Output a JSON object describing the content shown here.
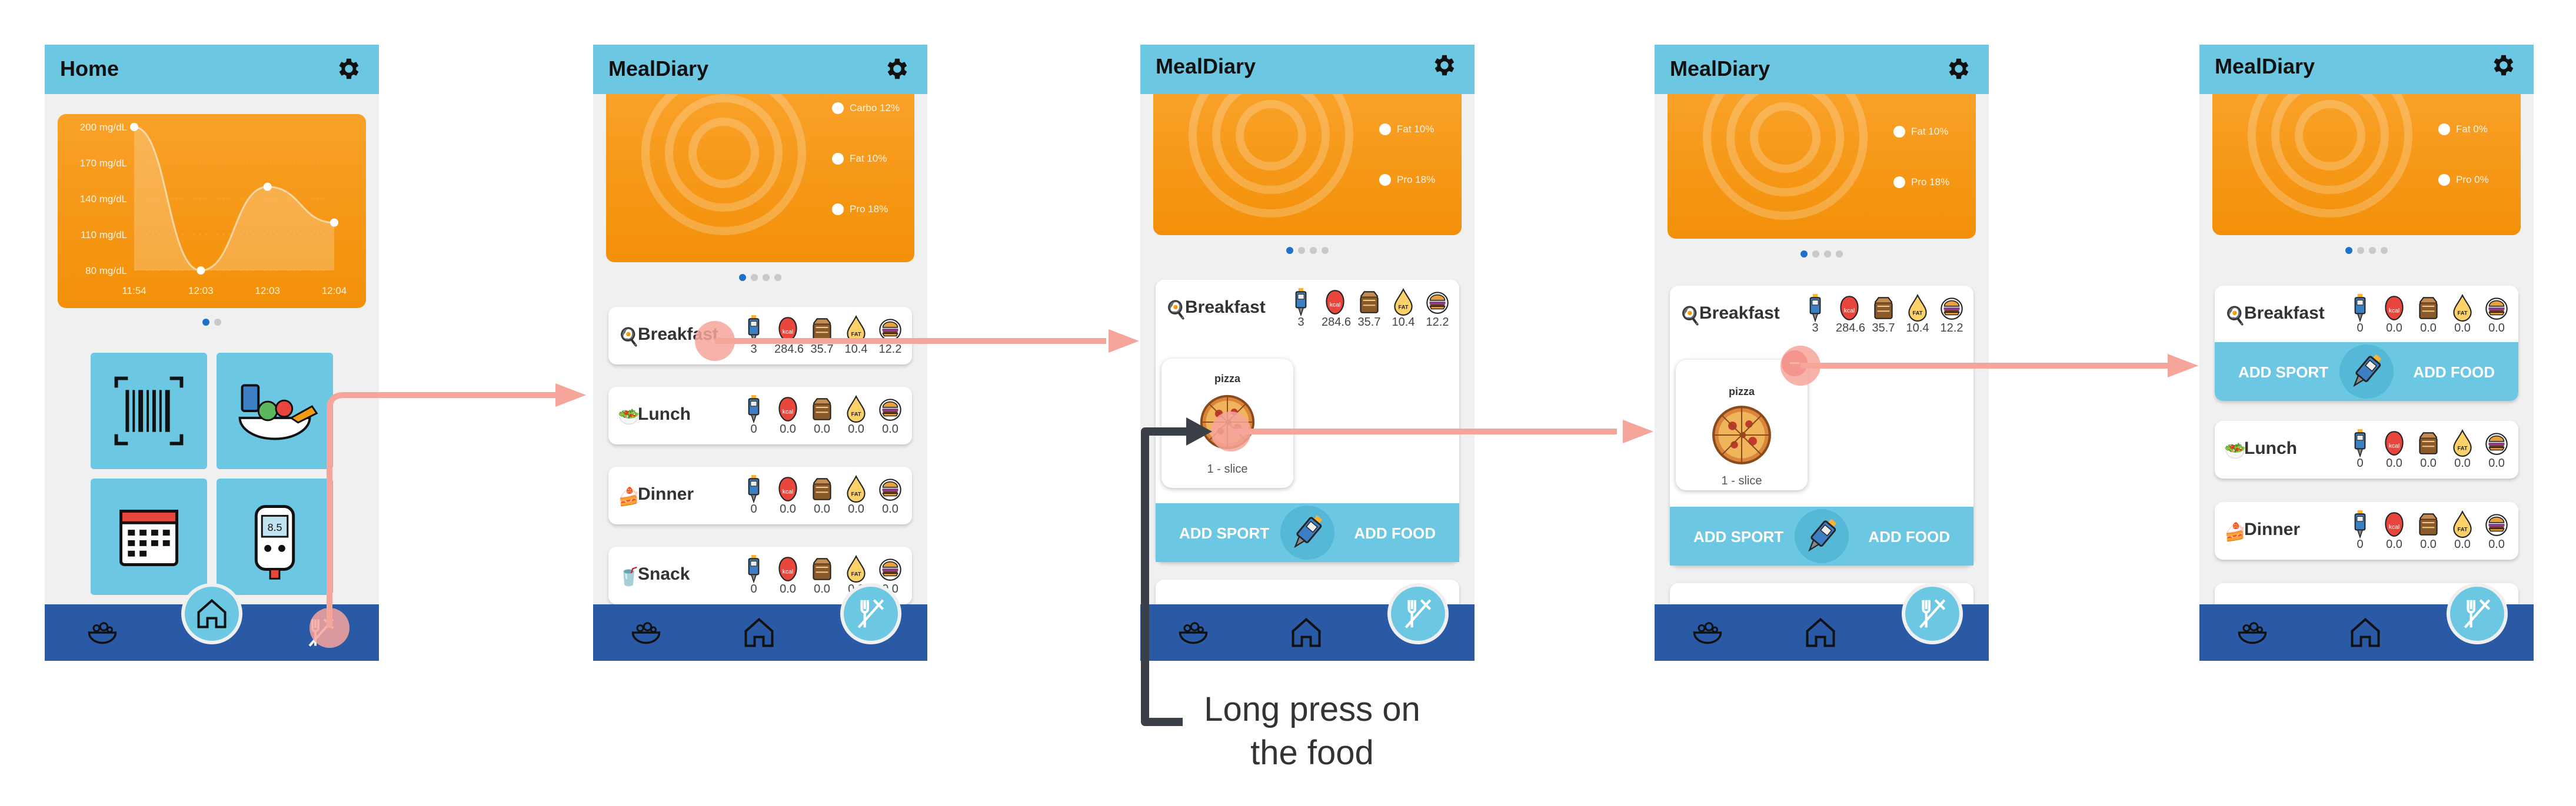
{
  "colors": {
    "header": "#6cc8e2",
    "navbar": "#2a5aa6",
    "orange": "#f7960f",
    "arrow": "#f6a59b",
    "accent": "#1e73c8"
  },
  "screen1": {
    "title": "Home",
    "chart_data": {
      "type": "area",
      "ylabels": [
        "200 mg/dL",
        "170 mg/dL",
        "140 mg/dL",
        "110 mg/dL",
        "80 mg/dL"
      ],
      "xlabels": [
        "11:54",
        "12:03",
        "12:03",
        "12:04"
      ],
      "ylim": [
        80,
        200
      ],
      "values": [
        200,
        80,
        150,
        120
      ]
    },
    "tiles": [
      "barcode-icon",
      "food-icon",
      "calendar-icon",
      "glucose-meter-icon"
    ]
  },
  "screen2": {
    "title": "MealDiary",
    "legend": [
      "Carbo 12%",
      "Fat 10%",
      "Pro 18%"
    ],
    "meals": [
      {
        "name": "Breakfast",
        "icon": "breakfast-icon",
        "values": [
          "3",
          "284.6",
          "35.7",
          "10.4",
          "12.2"
        ]
      },
      {
        "name": "Lunch",
        "icon": "lunch-icon",
        "values": [
          "0",
          "0.0",
          "0.0",
          "0.0",
          "0.0"
        ]
      },
      {
        "name": "Dinner",
        "icon": "dinner-icon",
        "values": [
          "0",
          "0.0",
          "0.0",
          "0.0",
          "0.0"
        ]
      },
      {
        "name": "Snack",
        "icon": "snack-icon",
        "values": [
          "0",
          "0.0",
          "0.0",
          "0.0",
          "0.0"
        ]
      }
    ]
  },
  "screen3": {
    "title": "MealDiary",
    "legend": [
      "Fat 10%",
      "Pro 18%"
    ],
    "meal": {
      "name": "Breakfast",
      "values": [
        "3",
        "284.6",
        "35.7",
        "10.4",
        "12.2"
      ]
    },
    "food": {
      "name": "pizza",
      "qty": "1 - slice"
    },
    "add_sport": "ADD SPORT",
    "add_food": "ADD FOOD",
    "caption": "Long press on the food"
  },
  "screen4": {
    "title": "MealDiary",
    "legend": [
      "Fat 10%",
      "Pro 18%"
    ],
    "meal": {
      "name": "Breakfast",
      "values": [
        "3",
        "284.6",
        "35.7",
        "10.4",
        "12.2"
      ]
    },
    "food": {
      "name": "pizza",
      "qty": "1 - slice"
    },
    "delete_sign": "–",
    "add_sport": "ADD SPORT",
    "add_food": "ADD FOOD"
  },
  "screen5": {
    "title": "MealDiary",
    "legend": [
      "Fat 0%",
      "Pro 0%"
    ],
    "add_sport": "ADD SPORT",
    "add_food": "ADD FOOD",
    "meals": [
      {
        "name": "Breakfast",
        "values": [
          "0",
          "0.0",
          "0.0",
          "0.0",
          "0.0"
        ]
      },
      {
        "name": "Lunch",
        "values": [
          "0",
          "0.0",
          "0.0",
          "0.0",
          "0.0"
        ]
      },
      {
        "name": "Dinner",
        "values": [
          "0",
          "0.0",
          "0.0",
          "0.0",
          "0.0"
        ]
      }
    ]
  },
  "nutrient_icons": [
    "insulin-pen-icon",
    "calorie-icon",
    "carbs-bread-icon",
    "fat-drop-icon",
    "protein-burger-icon"
  ],
  "nav_icons": [
    "meal-bowl-icon",
    "home-icon",
    "fork-knife-icon"
  ]
}
